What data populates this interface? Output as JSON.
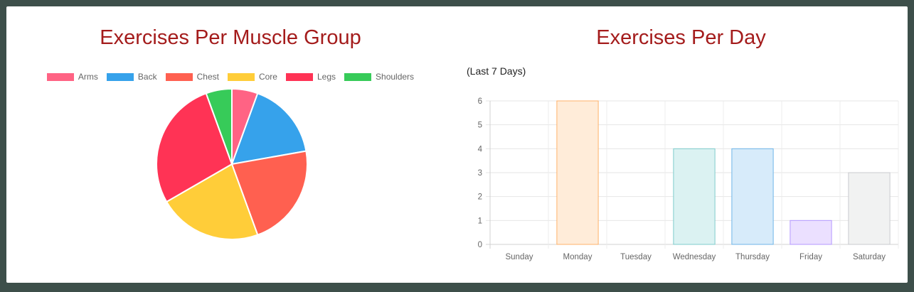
{
  "pie_panel": {
    "title": "Exercises Per Muscle Group"
  },
  "bar_panel": {
    "title": "Exercises Per Day",
    "subtitle": "(Last 7 Days)"
  },
  "chart_data": [
    {
      "type": "pie",
      "title": "Exercises Per Muscle Group",
      "categories": [
        "Arms",
        "Back",
        "Chest",
        "Core",
        "Legs",
        "Shoulders"
      ],
      "values": [
        1,
        3,
        4,
        4,
        5,
        1
      ],
      "colors": [
        "#ff6384",
        "#36a2eb",
        "#ff6050",
        "#ffcd39",
        "#ff3355",
        "#37cb59"
      ],
      "legend_position": "top"
    },
    {
      "type": "bar",
      "title": "Exercises Per Day",
      "subtitle": "(Last 7 Days)",
      "categories": [
        "Sunday",
        "Monday",
        "Tuesday",
        "Wednesday",
        "Thursday",
        "Friday",
        "Saturday"
      ],
      "values": [
        0,
        6,
        0,
        4,
        4,
        1,
        3
      ],
      "fills": [
        "#ffe5cc",
        "#ffecd9",
        "#e8d8f0",
        "#dbf2f2",
        "#d7ebfa",
        "#ebe0ff",
        "#f1f2f2"
      ],
      "borders": [
        "#ffa040",
        "#ffb26b",
        "#c9a3e0",
        "#7fcccc",
        "#6fb5e8",
        "#b499ff",
        "#c9cbcf"
      ],
      "ylim": [
        0,
        6
      ],
      "yticks": [
        0,
        1,
        2,
        3,
        4,
        5,
        6
      ],
      "grid": true
    }
  ]
}
